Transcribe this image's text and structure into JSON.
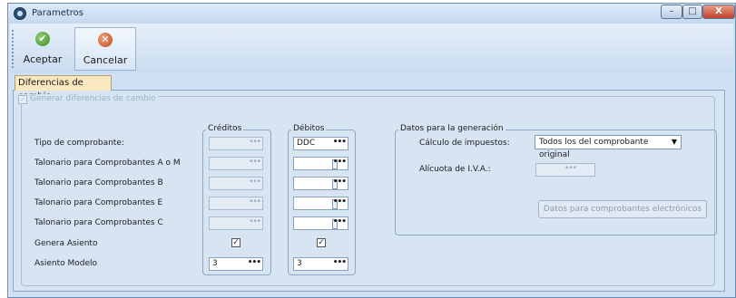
{
  "window": {
    "title": "Parametros",
    "controls": {
      "minimize": "–",
      "maximize": "□",
      "close": "X"
    }
  },
  "toolbar": {
    "accept_label": "Aceptar",
    "accept_icon": "check-icon",
    "cancel_label": "Cancelar",
    "cancel_icon": "x-circle-icon"
  },
  "tab": {
    "label": "Diferencias de cambio"
  },
  "generar": {
    "label": "Generar diferencias de cambio",
    "checked": true,
    "enabled": false
  },
  "creditos": {
    "title": "Créditos"
  },
  "debitos": {
    "title": "Débitos"
  },
  "rows": [
    {
      "label": "Tipo de comprobante:",
      "credito": "",
      "debito": "DDC"
    },
    {
      "label": "Talonario para Comprobantes A o M",
      "credito": "",
      "debito": ""
    },
    {
      "label": "Talonario para Comprobantes B",
      "credito": "",
      "debito": ""
    },
    {
      "label": "Talonario para Comprobantes E",
      "credito": "",
      "debito": ""
    },
    {
      "label": "Talonario para Comprobantes C",
      "credito": "",
      "debito": ""
    }
  ],
  "genera_asiento": {
    "label": "Genera Asiento",
    "credito_checked": true,
    "debito_checked": true
  },
  "asiento_modelo": {
    "label": "Asiento Modelo",
    "credito": "3",
    "debito": "3"
  },
  "lookup_button": "•••",
  "datos": {
    "title": "Datos para la generación",
    "calculo_label": "Cálculo de impuestos:",
    "calculo_value": "Todos los del comprobante original",
    "alicuota_label": "Alícuota de I.V.A.:",
    "electronicos_button": "Datos para comprobantes electrónicos"
  }
}
